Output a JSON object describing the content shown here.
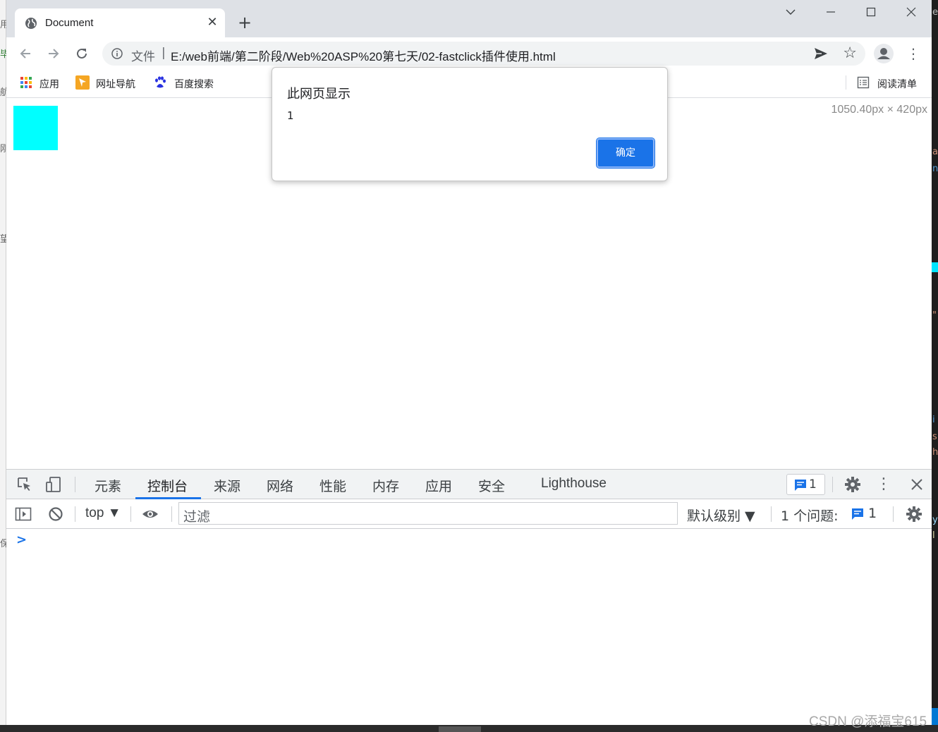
{
  "browser": {
    "tab_title": "Document",
    "address": {
      "scheme_label": "文件",
      "separator": "|",
      "url": "E:/web前端/第二阶段/Web%20ASP%20第七天/02-fastclick插件使用.html"
    },
    "bookmarks": [
      {
        "label": "应用",
        "icon": "apps-grid-icon"
      },
      {
        "label": "网址导航",
        "icon": "nav-arrow-icon"
      },
      {
        "label": "百度搜索",
        "icon": "baidu-paw-icon"
      }
    ],
    "reading_list_label": "阅读清单"
  },
  "viewport": {
    "dimensions_overlay": "1050.40px × 420px",
    "box_color": "#00ffff"
  },
  "dialog": {
    "title": "此网页显示",
    "message": "1",
    "ok_label": "确定"
  },
  "devtools": {
    "tabs": [
      "元素",
      "控制台",
      "来源",
      "网络",
      "性能",
      "内存",
      "应用",
      "安全",
      "Lighthouse"
    ],
    "active_tab": "控制台",
    "issues_badge_count": "1",
    "console": {
      "context": "top ▼",
      "filter_placeholder": "过滤",
      "levels": "默认级别 ▼",
      "issues_label": "1 个问题:",
      "issues_count": "1",
      "prompt": ">"
    }
  },
  "colors": {
    "accent": "#1a73e8",
    "tabstrip": "#dee1e6"
  },
  "background_editor": {
    "left_glyphs": [
      "用",
      "毕",
      "航",
      "刚",
      "望",
      "保"
    ],
    "right_glyphs": [
      "e",
      "a",
      "n",
      "\"",
      "i",
      "s",
      "h",
      "y",
      "l"
    ]
  },
  "watermark": "CSDN @添福宝615"
}
